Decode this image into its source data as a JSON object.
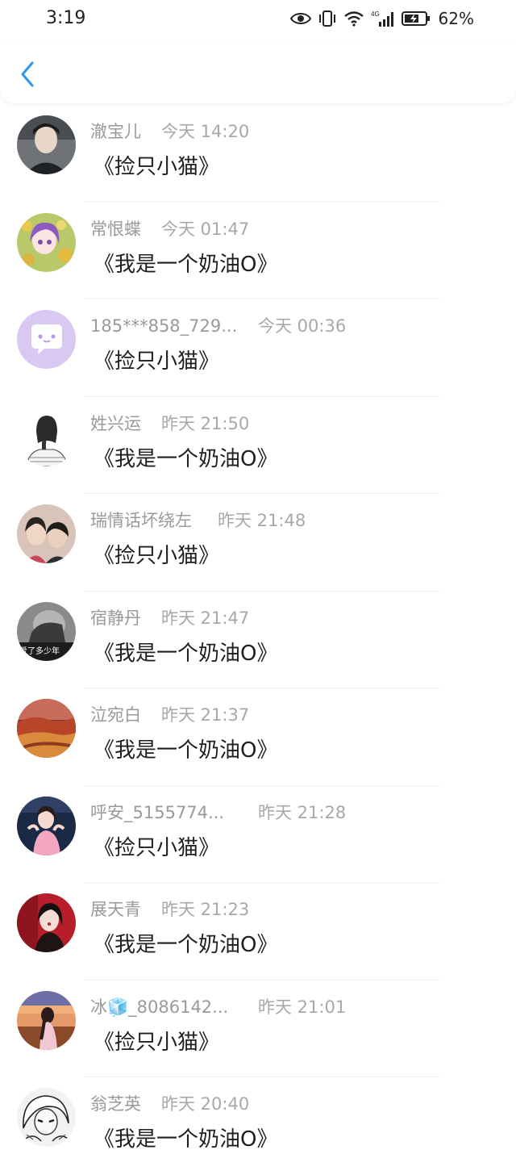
{
  "status_bar": {
    "time": "3:19",
    "battery": "62%",
    "network": "4G"
  },
  "colors": {
    "accent": "#2f9be6"
  },
  "items": [
    {
      "name": "澈宝儿",
      "time": "今天 14:20",
      "title": "《捡只小猫》",
      "avatar": "boy-portrait"
    },
    {
      "name": "常恨蝶",
      "time": "今天 01:47",
      "title": "《我是一个奶油O》",
      "avatar": "anime-girl-flowers"
    },
    {
      "name": "185***858_729...",
      "time": "今天 00:36",
      "title": "《捡只小猫》",
      "avatar": "default-chat-bubble"
    },
    {
      "name": "姓兴运",
      "time": "昨天 21:50",
      "title": "《我是一个奶油O》",
      "avatar": "sketch-girl-braid"
    },
    {
      "name": "瑞情话坏绕左",
      "time": "昨天 21:48",
      "title": "《捡只小猫》",
      "avatar": "couple-photo"
    },
    {
      "name": "宿静丹",
      "time": "昨天 21:47",
      "title": "《我是一个奶油O》",
      "avatar": "bw-photo",
      "avatar_text": "爱了多少年"
    },
    {
      "name": "泣宛白",
      "time": "昨天 21:37",
      "title": "《我是一个奶油O》",
      "avatar": "autumn-landscape"
    },
    {
      "name": "呼安_5155774...",
      "time": "昨天 21:28",
      "title": "《捡只小猫》",
      "avatar": "girl-pink"
    },
    {
      "name": "展天青",
      "time": "昨天 21:23",
      "title": "《我是一个奶油O》",
      "avatar": "girl-red"
    },
    {
      "name": "冰🧊_8086142...",
      "time": "昨天 21:01",
      "title": "《捡只小猫》",
      "avatar": "sunset-girl"
    },
    {
      "name": "翁芝英",
      "time": "昨天 20:40",
      "title": "《我是一个奶油O》",
      "avatar": "white-hair-anime"
    }
  ]
}
